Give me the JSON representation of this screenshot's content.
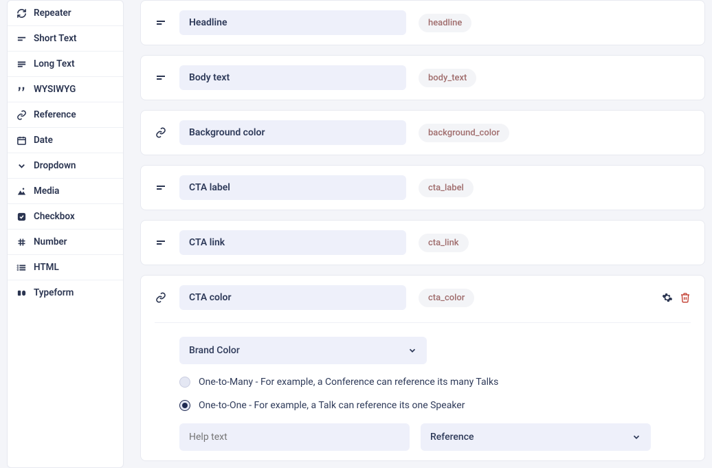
{
  "sidebar": {
    "items": [
      {
        "label": "Repeater",
        "icon": "refresh-icon"
      },
      {
        "label": "Short Text",
        "icon": "short-text-icon"
      },
      {
        "label": "Long Text",
        "icon": "long-text-icon"
      },
      {
        "label": "WYSIWYG",
        "icon": "quote-icon"
      },
      {
        "label": "Reference",
        "icon": "link-icon"
      },
      {
        "label": "Date",
        "icon": "calendar-icon"
      },
      {
        "label": "Dropdown",
        "icon": "chevron-down-icon"
      },
      {
        "label": "Media",
        "icon": "image-icon"
      },
      {
        "label": "Checkbox",
        "icon": "checkbox-icon"
      },
      {
        "label": "Number",
        "icon": "hash-icon"
      },
      {
        "label": "HTML",
        "icon": "list-icon"
      },
      {
        "label": "Typeform",
        "icon": "typeform-icon"
      }
    ]
  },
  "fields": [
    {
      "name": "Headline",
      "slug": "headline",
      "type": "short"
    },
    {
      "name": "Body text",
      "slug": "body_text",
      "type": "short"
    },
    {
      "name": "Background color",
      "slug": "background_color",
      "type": "reference"
    },
    {
      "name": "CTA label",
      "slug": "cta_label",
      "type": "short"
    },
    {
      "name": "CTA link",
      "slug": "cta_link",
      "type": "short"
    },
    {
      "name": "CTA color",
      "slug": "cta_color",
      "type": "reference",
      "expanded": true
    }
  ],
  "expanded": {
    "model_select": "Brand Color",
    "relation_options": [
      {
        "label": "One-to-Many - For example, a Conference can reference its many Talks",
        "checked": false
      },
      {
        "label": "One-to-One - For example, a Talk can reference its one Speaker",
        "checked": true
      }
    ],
    "help_placeholder": "Help text",
    "type_select": "Reference"
  }
}
